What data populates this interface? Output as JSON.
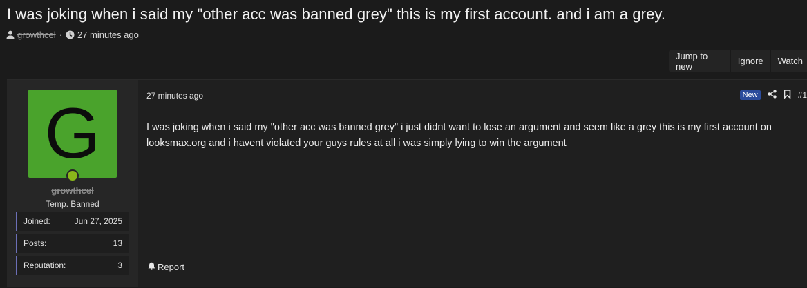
{
  "thread": {
    "title": "I was joking when i said my \"other acc was banned grey\" this is my first account. and i am a grey.",
    "author": "growthcel",
    "separator": "·",
    "time": "27 minutes ago"
  },
  "actions": {
    "jump_to_new": "Jump to new",
    "ignore": "Ignore",
    "watch": "Watch"
  },
  "post": {
    "avatar_letter": "G",
    "avatar_color": "#4aa32c",
    "username": "growthcel",
    "user_title": "Temp. Banned",
    "stats": [
      {
        "label": "Joined:",
        "value": "Jun 27, 2025"
      },
      {
        "label": "Posts:",
        "value": "13"
      },
      {
        "label": "Reputation:",
        "value": "3"
      }
    ],
    "date": "27 minutes ago",
    "new_badge": "New",
    "post_number": "#1",
    "body": "I was joking when i said my \"other acc was banned grey\" i just didnt want to lose an argument and seem like a grey this is my first account on looksmax.org and i havent violated your guys rules at all i was simply lying to win the argument",
    "report_label": "Report",
    "icons": {
      "share": "share-icon",
      "bookmark": "bookmark-icon",
      "report": "bell-icon"
    }
  }
}
